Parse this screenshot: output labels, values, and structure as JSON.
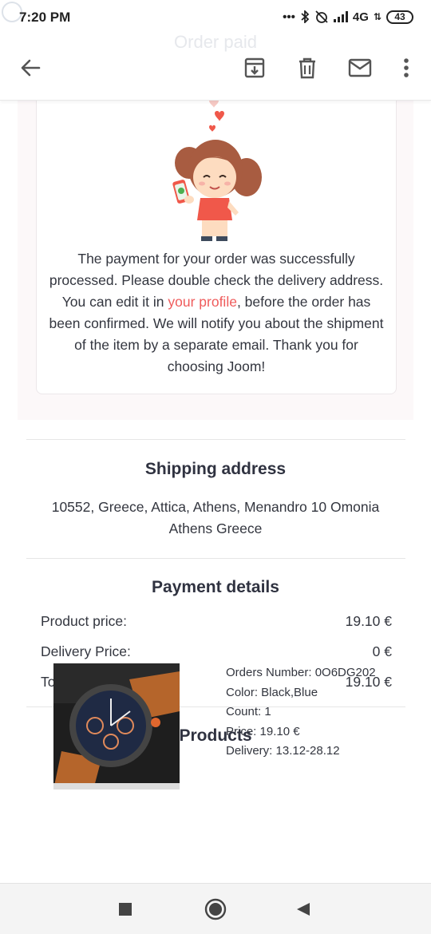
{
  "status_bar": {
    "time": "7:20 PM",
    "network": "4G",
    "battery": "43"
  },
  "header": {
    "faded_title": "Order paid"
  },
  "toolbar": {
    "back_icon": "arrow-left-icon",
    "archive_icon": "archive-icon",
    "delete_icon": "trash-icon",
    "mark_unread_icon": "mail-icon",
    "more_icon": "more-vert-icon"
  },
  "message": {
    "text_before_link": "The payment for your order was successfully processed. Please double check the delivery address. You can edit it in ",
    "link_text": "your profile",
    "text_after_link": ", before the order has been confirmed. We will notify you about the shipment of the item by a separate email. Thank you for choosing Joom!"
  },
  "shipping": {
    "title": "Shipping address",
    "address": "10552, Greece, Attica, Athens, Menandro 10 Omonia Athens Greece"
  },
  "payment": {
    "title": "Payment details",
    "rows": [
      {
        "label": "Product price:",
        "value": "19.10 €"
      },
      {
        "label": "Delivery Price:",
        "value": "0 €"
      },
      {
        "label": "Total:",
        "value": "19.10 €"
      }
    ]
  },
  "products": {
    "title": "Products",
    "items": [
      {
        "order_number": "Orders Number: 0O6DG202",
        "color": "Color: Black,Blue",
        "count": "Count: 1",
        "price": "Price: 19.10 €",
        "delivery": "Delivery: 13.12-28.12"
      }
    ]
  },
  "colors": {
    "accent_link": "#ef5b5b",
    "heart": "#f0584a"
  }
}
